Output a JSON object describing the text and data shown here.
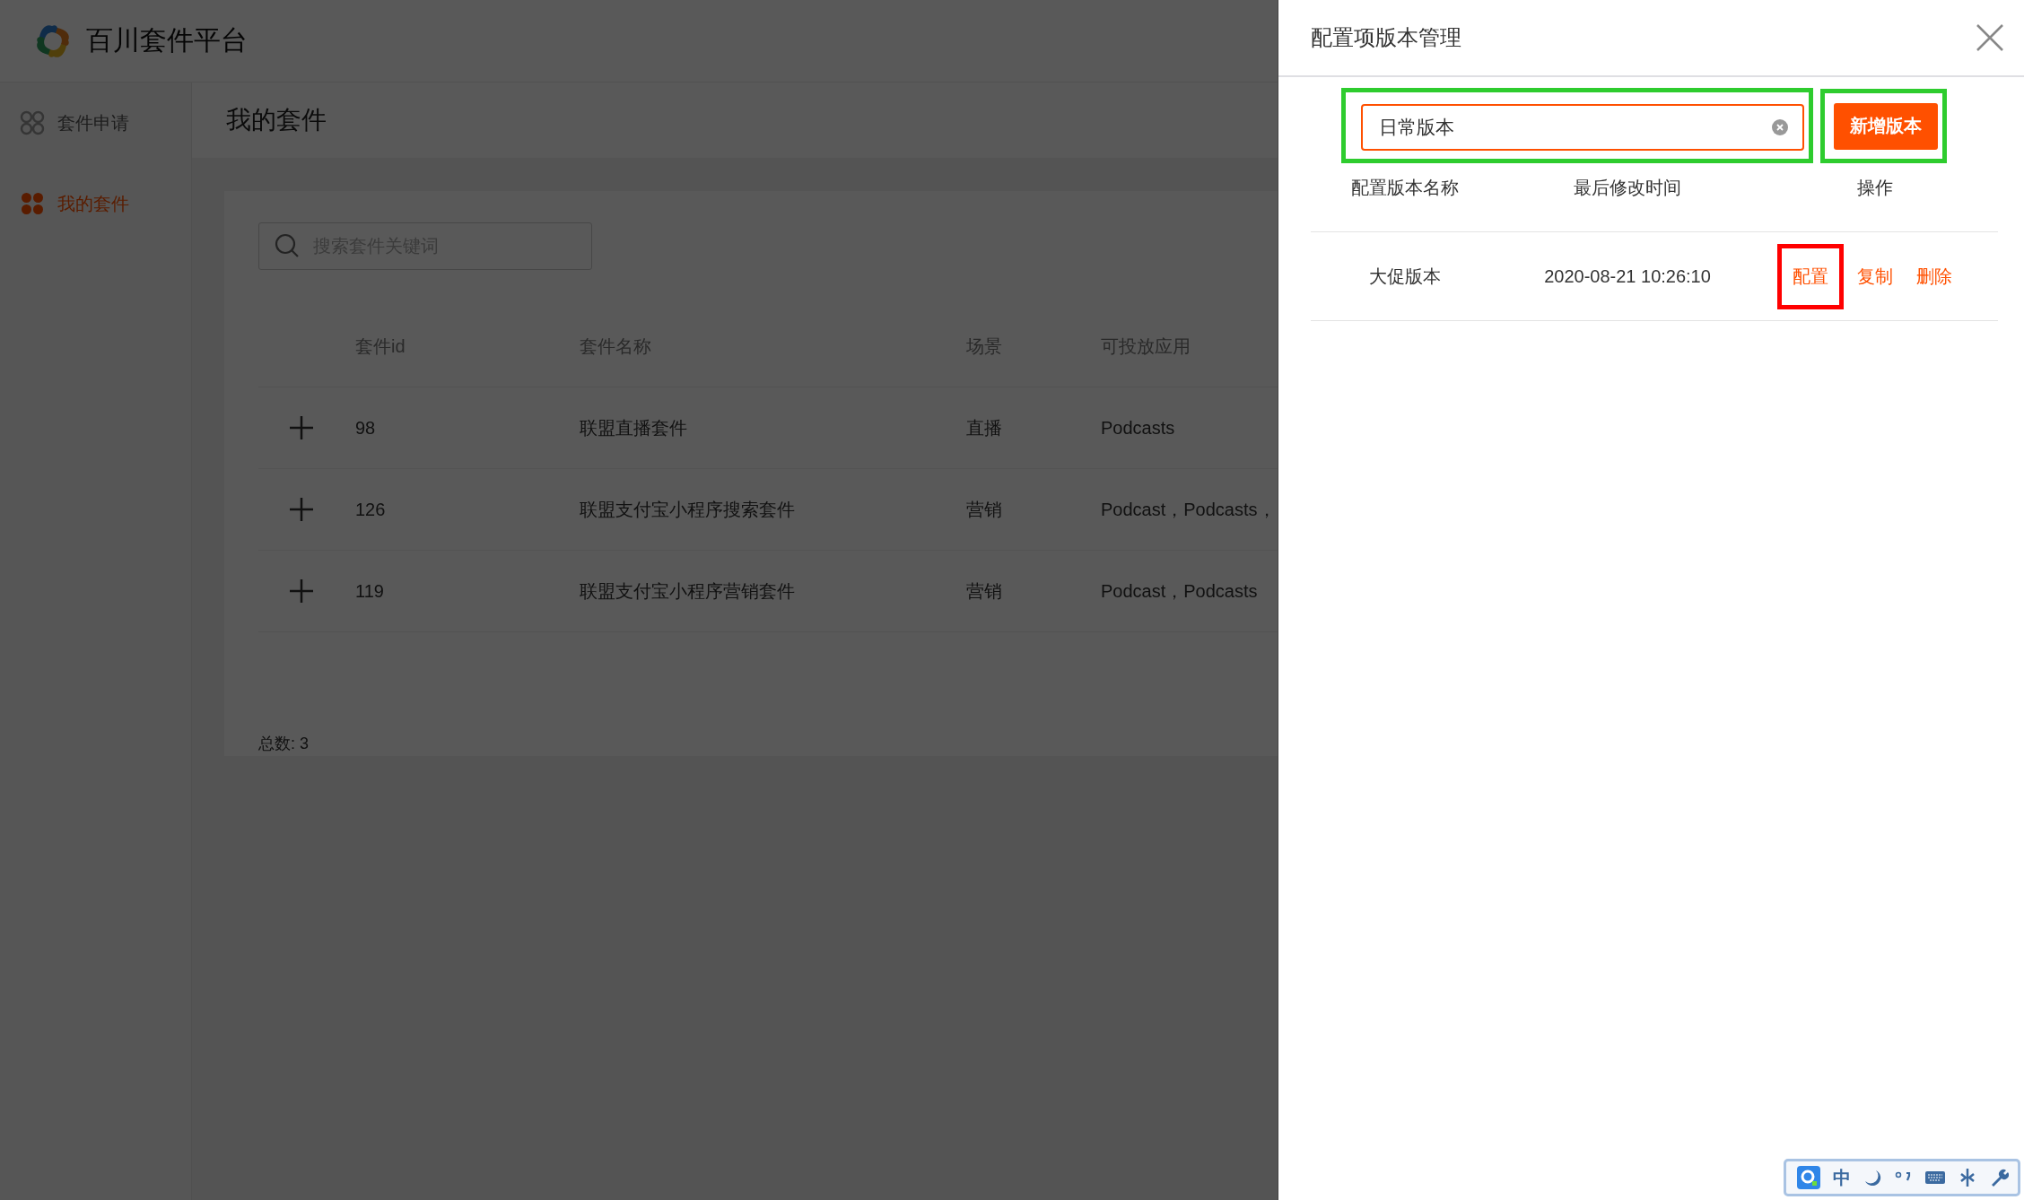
{
  "app": {
    "title": "百川套件平台"
  },
  "sidebar": {
    "items": [
      {
        "label": "套件申请",
        "selected": false
      },
      {
        "label": "我的套件",
        "selected": true
      }
    ]
  },
  "page": {
    "title": "我的套件",
    "search": {
      "placeholder": "搜索套件关键词"
    },
    "table": {
      "columns": [
        "套件id",
        "套件名称",
        "场景",
        "可投放应用"
      ],
      "rows": [
        {
          "id": "98",
          "name": "联盟直播套件",
          "scene": "直播",
          "apps": "Podcasts"
        },
        {
          "id": "126",
          "name": "联盟支付宝小程序搜索套件",
          "scene": "营销",
          "apps": "Podcast，Podcasts，"
        },
        {
          "id": "119",
          "name": "联盟支付宝小程序营销套件",
          "scene": "营销",
          "apps": "Podcast，Podcasts"
        }
      ]
    },
    "total": "总数: 3"
  },
  "drawer": {
    "title": "配置项版本管理",
    "name_field": {
      "value": "日常版本",
      "highlighted": true
    },
    "add_button": {
      "label": "新增版本",
      "highlighted": true
    },
    "table": {
      "columns": [
        "配置版本名称",
        "最后修改时间",
        "操作"
      ],
      "rows": [
        {
          "name": "大促版本",
          "modified": "2020-08-21 10:26:10",
          "actions": [
            {
              "label": "配置",
              "highlighted": true
            },
            {
              "label": "复制",
              "highlighted": false
            },
            {
              "label": "删除",
              "highlighted": false
            }
          ]
        }
      ]
    }
  },
  "ime_bar": {
    "mode": "中"
  }
}
